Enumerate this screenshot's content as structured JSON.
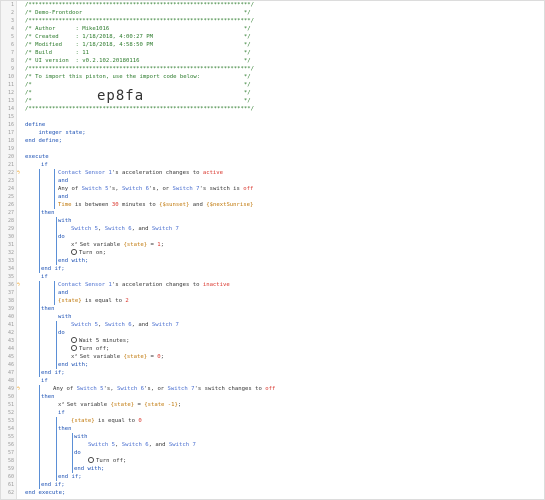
{
  "lines": [
    {
      "n": "1",
      "t": "/******************************************************************/",
      "c": "cm",
      "x": 24
    },
    {
      "n": "2",
      "t": "/* Demo-Frontdoor                                                */",
      "c": "cm",
      "x": 24
    },
    {
      "n": "3",
      "t": "/******************************************************************/",
      "c": "cm",
      "x": 24
    },
    {
      "n": "4",
      "t": "/* Author      : Mike1016                                        */",
      "c": "cm",
      "x": 24
    },
    {
      "n": "5",
      "t": "/* Created     : 1/18/2018, 4:00:27 PM                           */",
      "c": "cm",
      "x": 24
    },
    {
      "n": "6",
      "t": "/* Modified    : 1/18/2018, 4:58:50 PM                           */",
      "c": "cm",
      "x": 24
    },
    {
      "n": "7",
      "t": "/* Build       : 11                                              */",
      "c": "cm",
      "x": 24
    },
    {
      "n": "8",
      "t": "/* UI version  : v0.2.102.20180116                               */",
      "c": "cm",
      "x": 24
    },
    {
      "n": "9",
      "t": "/******************************************************************/",
      "c": "cm",
      "x": 24
    },
    {
      "n": "10",
      "t": "/* To import this piston, use the import code below:             */",
      "c": "cm",
      "x": 24
    },
    {
      "n": "11",
      "t": "/*                                                               */",
      "c": "cm",
      "x": 24
    },
    {
      "n": "12",
      "t": "/*                                                               */",
      "c": "cm",
      "x": 24
    },
    {
      "n": "13",
      "t": "/*                                                               */",
      "c": "cm",
      "x": 24
    },
    {
      "n": "14",
      "t": "/******************************************************************/",
      "c": "cm",
      "x": 24
    },
    {
      "n": "15",
      "t": "",
      "c": "plain",
      "x": 24
    },
    {
      "n": "16",
      "t": "define",
      "c": "kw",
      "x": 24
    },
    {
      "n": "17",
      "t": "    integer state;",
      "c": "kw",
      "x": 24
    },
    {
      "n": "18",
      "t": "end define;",
      "c": "kw",
      "x": 24
    },
    {
      "n": "19",
      "t": "",
      "c": "plain",
      "x": 24
    },
    {
      "n": "20",
      "t": "execute",
      "c": "kw",
      "x": 24
    },
    {
      "n": "21",
      "t": "if",
      "c": "kw",
      "x": 40
    },
    {
      "n": "22",
      "t": "",
      "c": "plain",
      "x": 57
    },
    {
      "n": "23",
      "t": "and",
      "c": "kw",
      "x": 57
    },
    {
      "n": "24",
      "t": "",
      "c": "plain",
      "x": 57
    },
    {
      "n": "25",
      "t": "and",
      "c": "kw",
      "x": 57
    },
    {
      "n": "26",
      "t": "",
      "c": "plain",
      "x": 57
    },
    {
      "n": "27",
      "t": "then",
      "c": "kw",
      "x": 40
    },
    {
      "n": "28",
      "t": "with",
      "c": "kw",
      "x": 57
    },
    {
      "n": "29",
      "t": "",
      "c": "plain",
      "x": 70
    },
    {
      "n": "30",
      "t": "do",
      "c": "kw",
      "x": 57
    },
    {
      "n": "31",
      "t": "",
      "c": "plain",
      "x": 70
    },
    {
      "n": "32",
      "t": "",
      "c": "plain",
      "x": 70
    },
    {
      "n": "33",
      "t": "end with;",
      "c": "kw",
      "x": 57
    },
    {
      "n": "34",
      "t": "end if;",
      "c": "kw",
      "x": 40
    },
    {
      "n": "35",
      "t": "if",
      "c": "kw",
      "x": 40
    },
    {
      "n": "36",
      "t": "",
      "c": "plain",
      "x": 57
    },
    {
      "n": "37",
      "t": "and",
      "c": "kw",
      "x": 57
    },
    {
      "n": "38",
      "t": "",
      "c": "plain",
      "x": 57
    },
    {
      "n": "39",
      "t": "then",
      "c": "kw",
      "x": 40
    },
    {
      "n": "40",
      "t": "with",
      "c": "kw",
      "x": 57
    },
    {
      "n": "41",
      "t": "",
      "c": "plain",
      "x": 70
    },
    {
      "n": "42",
      "t": "do",
      "c": "kw",
      "x": 57
    },
    {
      "n": "43",
      "t": "",
      "c": "plain",
      "x": 70
    },
    {
      "n": "44",
      "t": "",
      "c": "plain",
      "x": 70
    },
    {
      "n": "45",
      "t": "",
      "c": "plain",
      "x": 70
    },
    {
      "n": "46",
      "t": "end with;",
      "c": "kw",
      "x": 57
    },
    {
      "n": "47",
      "t": "end if;",
      "c": "kw",
      "x": 40
    },
    {
      "n": "48",
      "t": "if",
      "c": "kw",
      "x": 40
    },
    {
      "n": "49",
      "t": "",
      "c": "plain",
      "x": 52
    },
    {
      "n": "50",
      "t": "then",
      "c": "kw",
      "x": 40
    },
    {
      "n": "51",
      "t": "",
      "c": "plain",
      "x": 57
    },
    {
      "n": "52",
      "t": "if",
      "c": "kw",
      "x": 57
    },
    {
      "n": "53",
      "t": "",
      "c": "plain",
      "x": 70
    },
    {
      "n": "54",
      "t": "then",
      "c": "kw",
      "x": 57
    },
    {
      "n": "55",
      "t": "with",
      "c": "kw",
      "x": 73
    },
    {
      "n": "56",
      "t": "",
      "c": "plain",
      "x": 87
    },
    {
      "n": "57",
      "t": "do",
      "c": "kw",
      "x": 73
    },
    {
      "n": "58",
      "t": "",
      "c": "plain",
      "x": 87
    },
    {
      "n": "59",
      "t": "end with;",
      "c": "kw",
      "x": 73
    },
    {
      "n": "60",
      "t": "end if;",
      "c": "kw",
      "x": 57
    },
    {
      "n": "61",
      "t": "end if;",
      "c": "kw",
      "x": 40
    },
    {
      "n": "62",
      "t": "end execute;",
      "c": "kw",
      "x": 24
    }
  ],
  "import_code": "ep8fa",
  "stmts": {
    "c1a": "Contact Sensor 1",
    "c1b": "'s acceleration changes to ",
    "c1c": "active",
    "c2a": "Any of ",
    "c2b": "Switch 5",
    "c2c": "'s, ",
    "c2d": "Switch 6",
    "c2e": "'s, or ",
    "c2f": "Switch 7",
    "c2g": "'s switch is ",
    "c2h": "off",
    "c3a": "Time",
    "c3b": " is between ",
    "c3c": "30",
    "c3d": " minutes to ",
    "c3e": "{$sunset}",
    "c3f": " and ",
    "c3g": "{$nextSunrise}",
    "w1a": "Switch 5",
    "w1b": ", ",
    "w1c": "Switch 6",
    "w1d": ", and ",
    "w1e": "Switch 7",
    "a1a": "Set variable ",
    "a1b": "{state}",
    "a1c": " = ",
    "a1d": "1",
    "a1e": ";",
    "a2": "Turn on;",
    "c4a": "Contact Sensor 1",
    "c4b": "'s acceleration changes to ",
    "c4c": "inactive",
    "c5a": "{state}",
    "c5b": " is equal to ",
    "c5c": "2",
    "w2a": "Switch 5",
    "w2b": ", ",
    "w2c": "Switch 6",
    "w2d": ", and ",
    "w2e": "Switch 7",
    "a3": "Wait 5 minutes;",
    "a4": "Turn off;",
    "a5a": "Set variable ",
    "a5b": "{state}",
    "a5c": " = ",
    "a5d": "0",
    "a5e": ";",
    "c6a": "Any of ",
    "c6b": "Switch 5",
    "c6c": "'s, ",
    "c6d": "Switch 6",
    "c6e": "'s, or ",
    "c6f": "Switch 7",
    "c6g": "'s switch changes to ",
    "c6h": "off",
    "a6a": "Set variable ",
    "a6b": "{state}",
    "a6c": " = ",
    "a6d": "{state -1}",
    "a6e": ";",
    "c7a": "{state}",
    "c7b": " is equal to ",
    "c7c": "0",
    "w3a": "Switch 5",
    "w3b": ", ",
    "w3c": "Switch 6",
    "w3d": ", and ",
    "w3e": "Switch 7",
    "a7": "Turn off;",
    "x_icon": "x²"
  },
  "colors": {
    "comment": "#2a7a2a",
    "keyword": "#1a4fb3",
    "device": "#4a6fd0",
    "variable": "#c0780a",
    "value": "#d9342b",
    "block_bar": "#5b8fd6"
  },
  "icons": {
    "condition_marker": "lightning-icon",
    "action": "circle-icon",
    "variable": "variable-icon"
  }
}
